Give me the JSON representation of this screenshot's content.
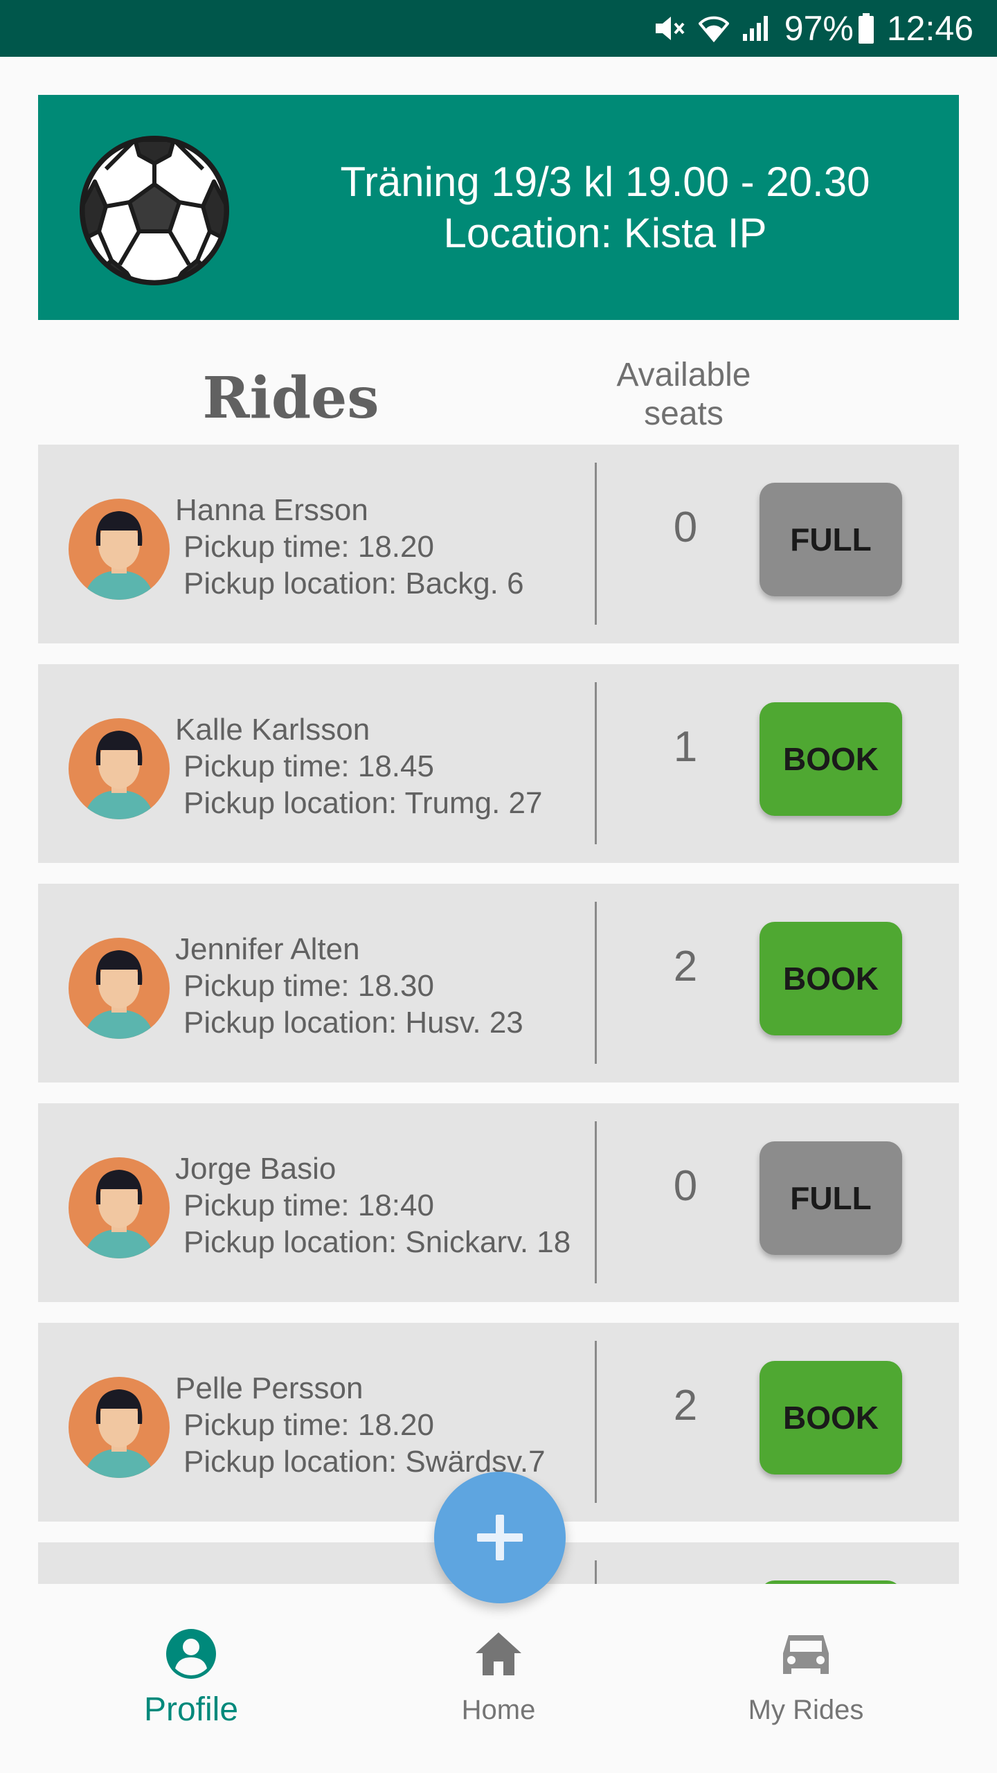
{
  "status_bar": {
    "battery": "97%",
    "time": "12:46"
  },
  "event": {
    "title": "Träning 19/3 kl 19.00 - 20.30",
    "location": "Location: Kista IP",
    "icon": "soccer-ball-icon"
  },
  "list_header": {
    "rides": "Rides",
    "seats_line1": "Available",
    "seats_line2": "seats"
  },
  "rides": [
    {
      "driver": "Hanna Ersson",
      "pickup_time": "Pickup time: 18.20",
      "pickup_location": "Pickup location: Backg. 6",
      "seats": "0",
      "action": "FULL",
      "status": "full"
    },
    {
      "driver": "Kalle Karlsson",
      "pickup_time": "Pickup time: 18.45",
      "pickup_location": "Pickup location: Trumg. 27",
      "seats": "1",
      "action": "BOOK",
      "status": "book"
    },
    {
      "driver": "Jennifer Alten",
      "pickup_time": "Pickup time: 18.30",
      "pickup_location": "Pickup location: Husv. 23",
      "seats": "2",
      "action": "BOOK",
      "status": "book"
    },
    {
      "driver": "Jorge Basio",
      "pickup_time": "Pickup time: 18:40",
      "pickup_location": "Pickup location: Snickarv. 18",
      "seats": "0",
      "action": "FULL",
      "status": "full"
    },
    {
      "driver": "Pelle Persson",
      "pickup_time": "Pickup time: 18.20",
      "pickup_location": "Pickup location: Swärdsv.7",
      "seats": "2",
      "action": "BOOK",
      "status": "book"
    }
  ],
  "fab": {
    "icon": "plus-icon"
  },
  "bottom_nav": {
    "items": [
      {
        "label": "Profile",
        "icon": "profile-icon",
        "active": true
      },
      {
        "label": "Home",
        "icon": "home-icon",
        "active": false
      },
      {
        "label": "My Rides",
        "icon": "car-icon",
        "active": false
      }
    ]
  },
  "colors": {
    "status_bar": "#00574b",
    "header": "#008a76",
    "accent": "#00897b",
    "book": "#4fa832",
    "full": "#8c8c8c",
    "fab": "#5ea5e0"
  }
}
